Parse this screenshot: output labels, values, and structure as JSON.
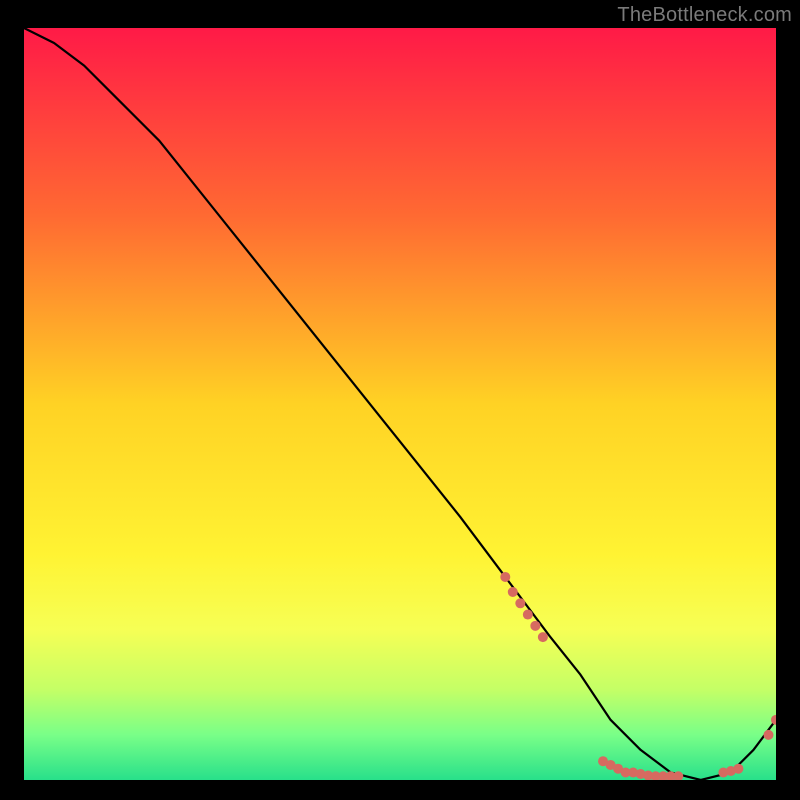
{
  "attribution": "TheBottleneck.com",
  "chart_data": {
    "type": "line",
    "title": "",
    "xlabel": "",
    "ylabel": "",
    "xlim": [
      0,
      100
    ],
    "ylim": [
      0,
      100
    ],
    "background_gradient_stops": [
      {
        "offset": 0.0,
        "color": "#ff1a47"
      },
      {
        "offset": 0.25,
        "color": "#ff6a32"
      },
      {
        "offset": 0.5,
        "color": "#ffd224"
      },
      {
        "offset": 0.7,
        "color": "#fff333"
      },
      {
        "offset": 0.8,
        "color": "#f6ff55"
      },
      {
        "offset": 0.88,
        "color": "#c4ff66"
      },
      {
        "offset": 0.94,
        "color": "#79ff88"
      },
      {
        "offset": 1.0,
        "color": "#28e08a"
      }
    ],
    "series": [
      {
        "name": "bottleneck-curve",
        "color": "#000000",
        "x": [
          0,
          4,
          8,
          12,
          18,
          26,
          34,
          42,
          50,
          58,
          64,
          70,
          74,
          78,
          82,
          86,
          90,
          94,
          97,
          100
        ],
        "y": [
          100,
          98,
          95,
          91,
          85,
          75,
          65,
          55,
          45,
          35,
          27,
          19,
          14,
          8,
          4,
          1,
          0,
          1,
          4,
          8
        ]
      }
    ],
    "markers": [
      {
        "name": "bottleneck-samples",
        "shape": "circle",
        "color": "#d66a60",
        "radius_px": 5,
        "points": [
          {
            "x": 64,
            "y": 27
          },
          {
            "x": 65,
            "y": 25
          },
          {
            "x": 66,
            "y": 23.5
          },
          {
            "x": 67,
            "y": 22
          },
          {
            "x": 68,
            "y": 20.5
          },
          {
            "x": 69,
            "y": 19
          },
          {
            "x": 77,
            "y": 2.5
          },
          {
            "x": 78,
            "y": 2
          },
          {
            "x": 79,
            "y": 1.5
          },
          {
            "x": 80,
            "y": 1
          },
          {
            "x": 81,
            "y": 1
          },
          {
            "x": 82,
            "y": 0.8
          },
          {
            "x": 83,
            "y": 0.6
          },
          {
            "x": 84,
            "y": 0.5
          },
          {
            "x": 85,
            "y": 0.5
          },
          {
            "x": 86,
            "y": 0.5
          },
          {
            "x": 87,
            "y": 0.5
          },
          {
            "x": 93,
            "y": 1
          },
          {
            "x": 94,
            "y": 1.2
          },
          {
            "x": 95,
            "y": 1.5
          },
          {
            "x": 99,
            "y": 6
          },
          {
            "x": 100,
            "y": 8
          }
        ]
      }
    ]
  }
}
